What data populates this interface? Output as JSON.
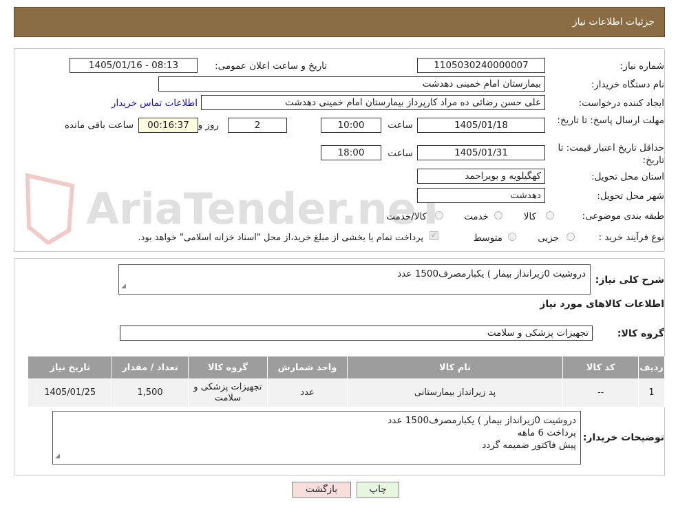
{
  "header": {
    "title": "جزئیات اطلاعات نیاز"
  },
  "watermark": {
    "text": "AriaTender.neT"
  },
  "form": {
    "need_number_label": "شماره نیاز:",
    "need_number": "1105030240000007",
    "announce_label": "تاریخ و ساعت اعلان عمومی:",
    "announce_value": "1405/01/16 - 08:13",
    "buyer_org_label": "نام دستگاه خریدار:",
    "buyer_org": "بیمارستان امام خمینی دهدشت",
    "creator_label": "ایجاد کننده درخواست:",
    "creator": "علی حسن رضائی ده مراد کارپرداز بیمارستان امام خمینی دهدشت",
    "contact_link": "اطلاعات تماس خریدار",
    "deadline_label": "مهلت ارسال پاسخ: تا تاریخ:",
    "deadline_date": "1405/01/18",
    "time_label": "ساعت",
    "deadline_time": "10:00",
    "days_value": "2",
    "days_label": "روز و",
    "remaining_value": "00:16:37",
    "remaining_label": "ساعت باقی مانده",
    "validity_label": "حداقل تاریخ اعتبار قیمت: تا تاریخ:",
    "validity_date": "1405/01/31",
    "validity_time": "18:00",
    "province_label": "استان محل تحویل:",
    "province": "کهگیلویه و بویراحمد",
    "city_label": "شهر محل تحویل:",
    "city": "دهدشت",
    "category_label": "طبقه بندی موضوعی:",
    "category_options": [
      "کالا",
      "خدمت",
      "کالا/خدمت"
    ],
    "process_label": "نوع فرآیند خرید :",
    "process_options": [
      "جزیی",
      "متوسط"
    ],
    "payment_note": "پرداخت تمام یا بخشی از مبلغ خرید،از محل \"اسناد خزانه اسلامی\" خواهد بود."
  },
  "details": {
    "description_label": "شرح کلی نیاز:",
    "description": "دروشیت 0زیرانداز بیمار ) یکبارمصرف1500 عدد",
    "goods_info_title": "اطلاعات کالاهای مورد نیاز",
    "goods_group_label": "گروه کالا:",
    "goods_group": "تجهیزات پزشکی و سلامت",
    "table": {
      "headers": [
        "ردیف",
        "کد کالا",
        "نام کالا",
        "واحد شمارش",
        "گروه کالا",
        "تعداد / مقدار",
        "تاریخ نیاز"
      ],
      "rows": [
        [
          "1",
          "--",
          "پد زیرانداز بیمارستانی",
          "عدد",
          "تجهیزات پزشکی و سلامت",
          "1,500",
          "1405/01/25"
        ]
      ]
    },
    "buyer_notes_label": "توضیحات خریدار:",
    "buyer_notes_lines": [
      "دروشیت 0زیرانداز بیمار ) یکبارمصرف1500 عدد",
      "پرداخت 6 ماهه",
      "پیش فاکتور ضمیمه گردد"
    ]
  },
  "buttons": {
    "print": "چاپ",
    "back": "بازگشت"
  },
  "colors": {
    "header_bg": "#8a6d43",
    "table_header_bg": "#9d9d9d",
    "print_bg": "#e8f7df",
    "back_bg": "#f9dede",
    "link": "#1a0dab"
  }
}
